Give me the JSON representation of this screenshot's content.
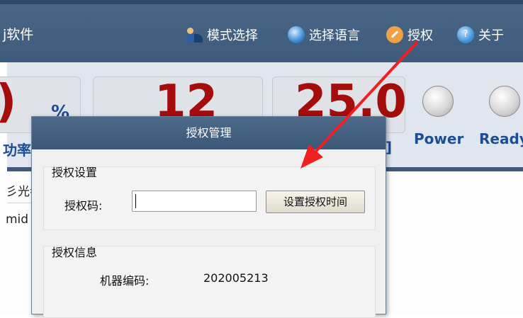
{
  "header": {
    "app_title": "j软件",
    "menu": [
      {
        "label": "模式选择",
        "icon": "users-icon"
      },
      {
        "label": "选择语言",
        "icon": "globe-icon"
      },
      {
        "label": "授权",
        "icon": "key-icon"
      },
      {
        "label": "关于",
        "icon": "help-icon"
      }
    ]
  },
  "gauges": {
    "card1": {
      "value_fragment": ")",
      "unit": "%",
      "label": "功率["
    },
    "card2": {
      "value": "12"
    },
    "card3": {
      "value": "25.0",
      "label_fragment": "]"
    },
    "leds": [
      {
        "label": "Power"
      },
      {
        "label": "Ready"
      }
    ]
  },
  "left_panel": {
    "line1": "彡光参",
    "line2": "mid"
  },
  "dialog": {
    "title": "授权管理",
    "auth_settings": {
      "title": "授权设置",
      "code_label": "授权码:",
      "code_value": "",
      "set_button": "设置授权时间"
    },
    "auth_info": {
      "title": "授权信息",
      "machine_label": "机器编码:",
      "machine_value": "202005213"
    }
  },
  "colors": {
    "header_bg": "#4a6686",
    "value_red": "#a50d0d",
    "label_blue": "#1d4d93",
    "arrow_red": "#f02020"
  }
}
